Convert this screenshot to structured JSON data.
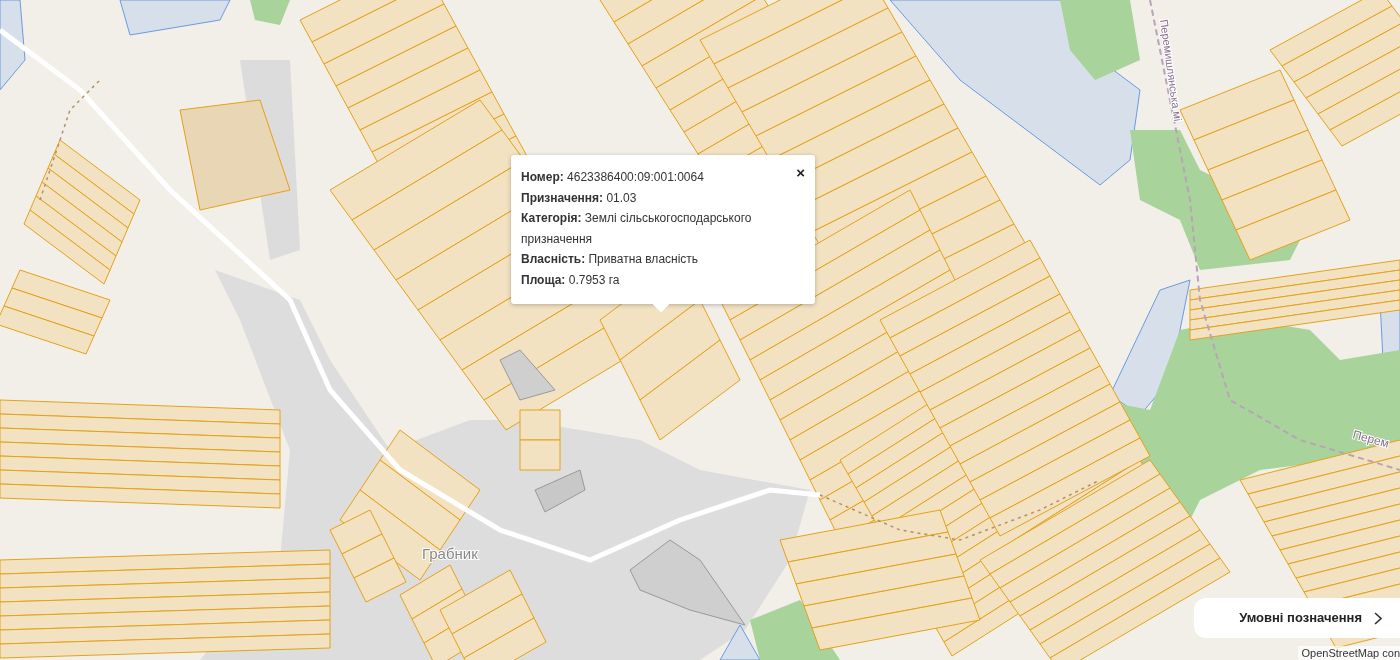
{
  "map": {
    "place_labels": [
      {
        "text": "Грабник",
        "kind": "settlement"
      },
      {
        "text": "Перемишлянська мі",
        "kind": "road-vertical"
      },
      {
        "text": "Перем",
        "kind": "road-right"
      }
    ],
    "attribution": "OpenStreetMap con"
  },
  "popup": {
    "close": "×",
    "fields": [
      {
        "label": "Номер:",
        "value": "4623386400:09:001:0064"
      },
      {
        "label": "Призначення:",
        "value": "01.03"
      },
      {
        "label": "Категорія:",
        "value": "Землі сільськогосподарського призначення"
      },
      {
        "label": "Власність:",
        "value": "Приватна власність"
      },
      {
        "label": "Площа:",
        "value": "0.7953 га"
      }
    ]
  },
  "legend_button": {
    "label": "Умовні позначення"
  }
}
